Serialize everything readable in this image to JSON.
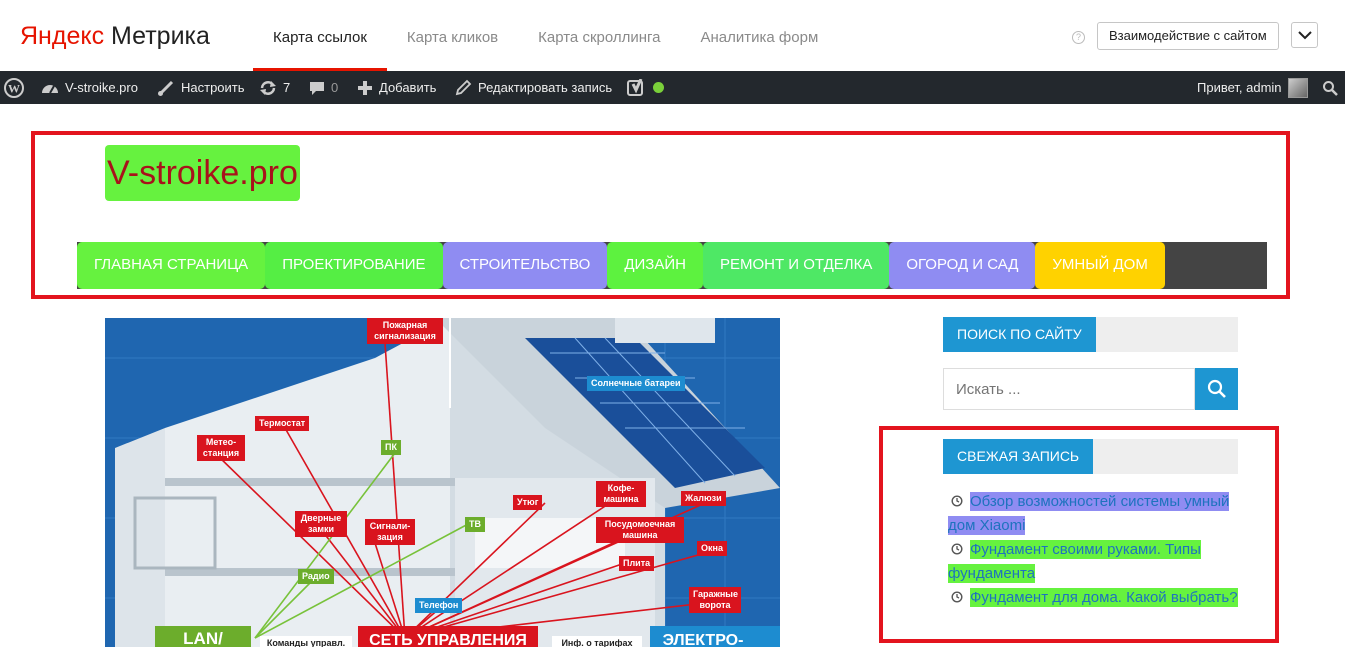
{
  "metrika": {
    "logo_yandex": "Яндекс",
    "logo_product": "Метрика",
    "tabs": [
      {
        "label": "Карта ссылок",
        "active": true
      },
      {
        "label": "Карта кликов",
        "active": false
      },
      {
        "label": "Карта скроллинга",
        "active": false
      },
      {
        "label": "Аналитика форм",
        "active": false
      }
    ],
    "help": "?",
    "interaction_button": "Взаимодействие с сайтом"
  },
  "adminbar": {
    "site": "V-stroike.pro",
    "customize": "Настроить",
    "updates": "7",
    "comments": "0",
    "add": "Добавить",
    "edit": "Редактировать запись",
    "greeting": "Привет, admin"
  },
  "site": {
    "title": "V-stroike.pro",
    "title_bg": "#66f23f",
    "title_color": "#a8121b",
    "nav": [
      {
        "label": "ГЛАВНАЯ СТРАНИЦА",
        "color": "#66f23f"
      },
      {
        "label": "ПРОЕКТИРОВАНИЕ",
        "color": "#55ee44"
      },
      {
        "label": "СТРОИТЕЛЬСТВО",
        "color": "#8f8cf2"
      },
      {
        "label": "ДИЗАЙН",
        "color": "#5df23f"
      },
      {
        "label": "РЕМОНТ И ОТДЕЛКА",
        "color": "#4ee865"
      },
      {
        "label": "ОГОРОД И САД",
        "color": "#8f8cf2"
      },
      {
        "label": "УМНЫЙ ДОМ",
        "color": "#ffd200"
      }
    ]
  },
  "hero": {
    "labels": {
      "fire_alarm": "Пожарная сигнализация",
      "solar": "Солнечные батареи",
      "thermostat": "Термостат",
      "weather": "Метео- станция",
      "pc": "ПК",
      "iron": "Утюг",
      "coffee": "Кофе- машина",
      "blinds": "Жалюзи",
      "doorlocks": "Дверные замки",
      "alarm": "Сигнали- зация",
      "tv": "ТВ",
      "dishwasher": "Посудомоечная машина",
      "windows": "Окна",
      "stove": "Плита",
      "radio": "Радио",
      "garage": "Гаражные ворота",
      "phone": "Телефон",
      "lan": "LAN/",
      "commands": "Команды управл.",
      "network": "СЕТЬ УПРАВЛЕНИЯ",
      "tariffs": "Инф. о тарифах",
      "electro": "ЭЛЕКТРО-"
    }
  },
  "sidebar": {
    "search_title": "ПОИСК ПО САЙТУ",
    "search_placeholder": "Искать ...",
    "recent_title": "СВЕЖАЯ ЗАПИСЬ",
    "recent": [
      {
        "title": "Обзор возможностей системы умный дом Xiaomi",
        "highlight": "#8f8cf2"
      },
      {
        "title": "Фундамент своими руками. Типы фундамента",
        "highlight": "#66f23f"
      },
      {
        "title": "Фундамент для дома. Какой выбрать?",
        "highlight": "#66f23f"
      }
    ]
  },
  "colors": {
    "accent_red": "#e3141e",
    "sidebar_blue": "#1e96d2",
    "adminbar": "#23282d"
  }
}
